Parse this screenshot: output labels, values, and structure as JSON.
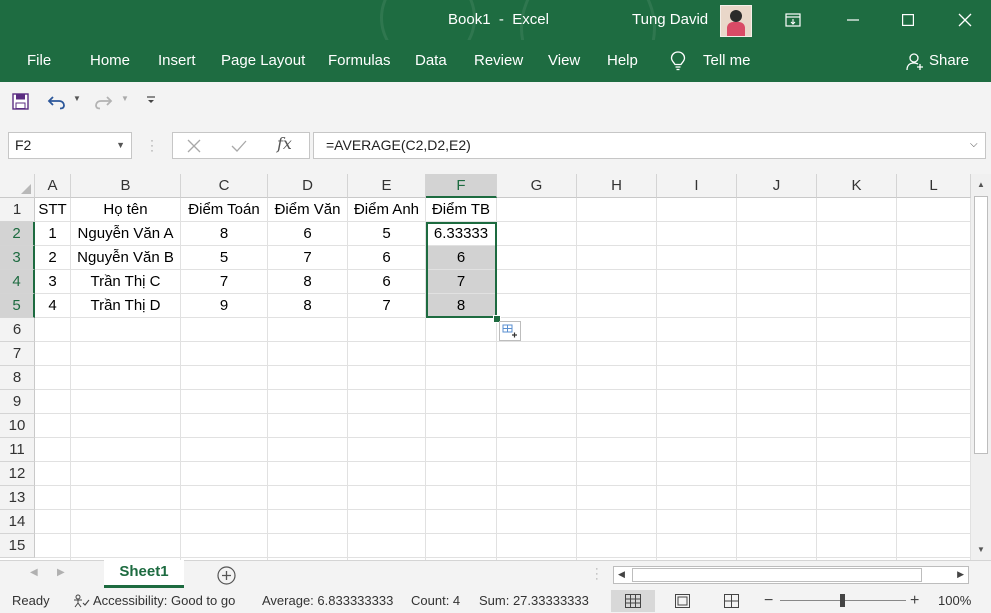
{
  "title": {
    "doc": "Book1",
    "sep": "-",
    "app": "Excel"
  },
  "user": "Tung David",
  "ribbon_tabs": [
    "File",
    "Home",
    "Insert",
    "Page Layout",
    "Formulas",
    "Data",
    "Review",
    "View",
    "Help"
  ],
  "tell_me": "Tell me",
  "share": "Share",
  "name_box": "F2",
  "formula": "=AVERAGE(C2,D2,E2)",
  "fx_label": "fx",
  "columns": [
    "A",
    "B",
    "C",
    "D",
    "E",
    "F",
    "G",
    "H",
    "I",
    "J",
    "K",
    "L"
  ],
  "rows": [
    "1",
    "2",
    "3",
    "4",
    "5",
    "6",
    "7",
    "8",
    "9",
    "10",
    "11",
    "12",
    "13",
    "14",
    "15"
  ],
  "table": {
    "header": [
      "STT",
      "Họ tên",
      "Điểm Toán",
      "Điểm Văn",
      "Điểm Anh",
      "Điểm TB"
    ],
    "data": [
      [
        "1",
        "Nguyễn Văn A",
        "8",
        "6",
        "5",
        "6.33333"
      ],
      [
        "2",
        "Nguyễn Văn B",
        "5",
        "7",
        "6",
        "6"
      ],
      [
        "3",
        "Trần Thị C",
        "7",
        "8",
        "6",
        "7"
      ],
      [
        "4",
        "Trần Thị D",
        "9",
        "8",
        "7",
        "8"
      ]
    ]
  },
  "sheet_tab": "Sheet1",
  "status": {
    "ready": "Ready",
    "accessibility": "Accessibility: Good to go",
    "average": "Average: 6.833333333",
    "count": "Count: 4",
    "sum": "Sum: 27.33333333",
    "zoom": "100%"
  },
  "colors": {
    "excel_green": "#1e6c41",
    "selection": "#1d6b40",
    "highlight": "#d2d2d2"
  }
}
